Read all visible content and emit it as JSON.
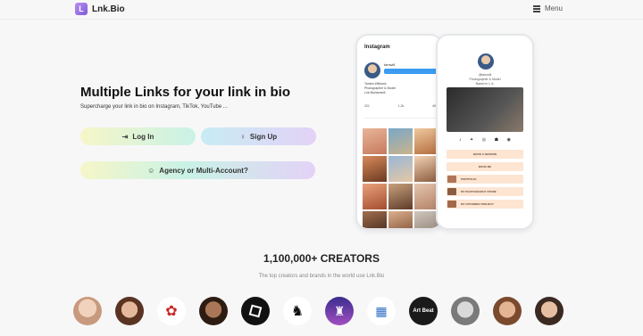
{
  "header": {
    "logo_text": "Lnk.Bio",
    "logo_mark": "L",
    "menu_label": "Menu",
    "menu_icon": "hamburger-icon"
  },
  "hero": {
    "headline": "Multiple Links for your link in bio",
    "subline": "Supercharge your link in bio on Instagram, TikTok, YouTube ...",
    "login_label": "Log In",
    "login_icon": "login-icon",
    "signup_label": "Sign Up",
    "signup_icon": "lightbulb-icon",
    "agency_label": "Agency or Multi-Account?",
    "agency_icon": "group-icon"
  },
  "phone_instagram": {
    "title": "Instagram",
    "handle": "tamwill",
    "bio": [
      "Tamira Williams",
      "Photographer & Model",
      "Lnk.Bio/tamwill"
    ],
    "stats": [
      "321",
      "1.2k",
      "405"
    ]
  },
  "phone_lnkbio": {
    "name_lines": [
      "@tamwill",
      "Photographer & Model",
      "Based in L.A."
    ],
    "social_icons": [
      "tiktok-icon",
      "twitter-icon",
      "instagram-icon",
      "snapchat-icon",
      "spotify-icon"
    ],
    "links": [
      "BOOK A SESSION",
      "BOOK ME",
      "PORTFOLIO",
      "MY PHOTOGRAPHY STORE",
      "MY UPCOMING PROJECT"
    ]
  },
  "creators": {
    "title": "1,100,000+ CREATORS",
    "subtitle": "The top creators and brands in the world use Lnk.Bio",
    "avatar_labels": [
      "",
      "",
      "",
      "",
      "",
      "",
      "",
      "",
      "Art Beat",
      "",
      "",
      ""
    ]
  },
  "colors": {
    "accent": "#7f5ad9",
    "instagram_follow": "#3b9cf2",
    "link_row": "#fde5d2"
  }
}
